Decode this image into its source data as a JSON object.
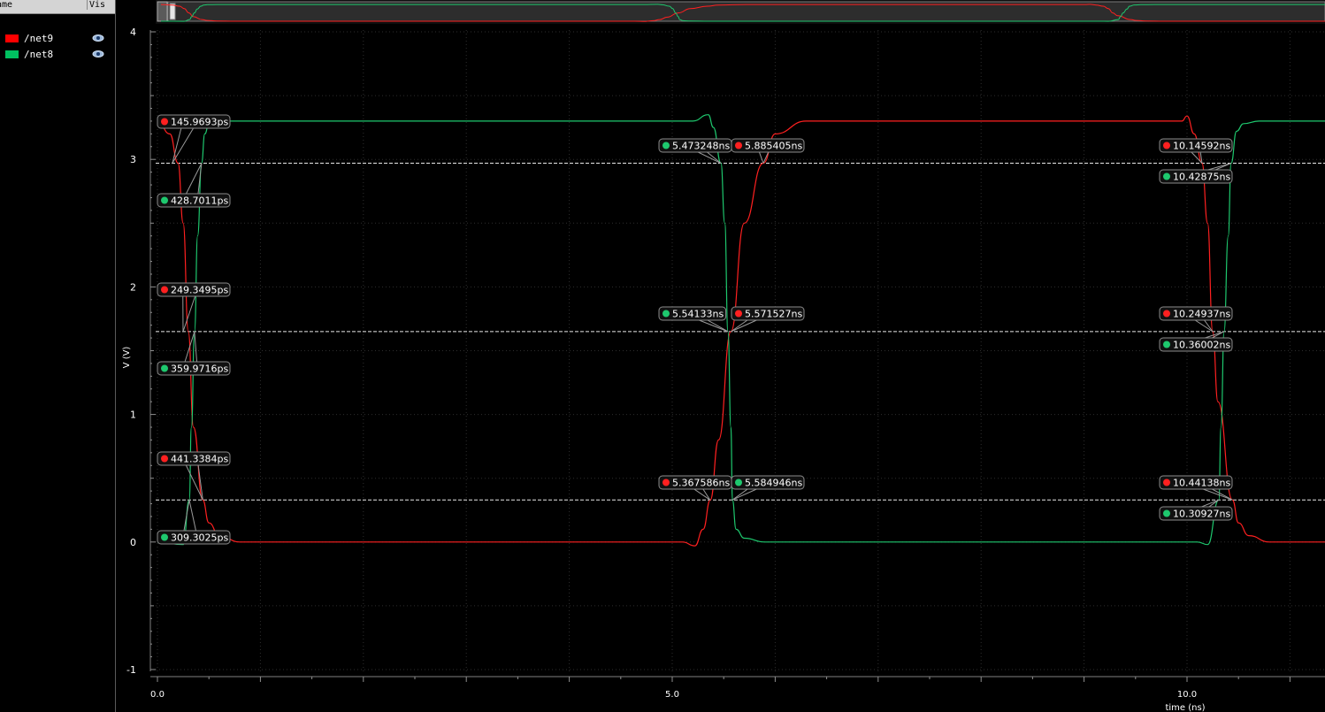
{
  "legend": {
    "header_name": "ame",
    "header_vis": "Vis",
    "items": [
      {
        "name": "/net9",
        "color": "#ff0000",
        "icon": "eye-icon"
      },
      {
        "name": "/net8",
        "color": "#00c060",
        "icon": "eye-icon"
      }
    ]
  },
  "colors": {
    "net9": "#ff2020",
    "net8": "#1ec86e",
    "background": "#000000",
    "grid": "#333333"
  },
  "chart_data": {
    "type": "line",
    "xlabel": "time (ns)",
    "ylabel": "V (V)",
    "xlim": [
      0,
      13.8
    ],
    "ylim": [
      -1,
      4
    ],
    "x_ticks": [
      "0.0",
      "5.0",
      "10.0"
    ],
    "y_ticks": [
      "4",
      "3",
      "2",
      "1",
      "0",
      "-1"
    ],
    "threshold_lines": [
      2.97,
      1.65,
      0.33
    ],
    "series": [
      {
        "name": "/net9",
        "color": "#ff2020",
        "x": [
          0.0,
          0.12,
          0.2,
          0.25,
          0.3,
          0.35,
          0.44,
          0.5,
          0.6,
          0.8,
          5.1,
          5.22,
          5.3,
          5.37,
          5.45,
          5.57,
          5.7,
          5.885,
          6.0,
          6.3,
          9.95,
          10.0,
          10.07,
          10.146,
          10.2,
          10.249,
          10.3,
          10.441,
          10.5,
          10.6,
          10.8,
          13.8
        ],
        "y": [
          3.3,
          3.2,
          2.97,
          2.5,
          1.65,
          0.9,
          0.33,
          0.15,
          0.05,
          0.0,
          0.0,
          -0.03,
          0.1,
          0.33,
          0.8,
          1.65,
          2.5,
          2.97,
          3.2,
          3.3,
          3.3,
          3.34,
          3.2,
          2.97,
          2.5,
          1.65,
          1.1,
          0.33,
          0.15,
          0.05,
          0.0,
          0.0
        ]
      },
      {
        "name": "/net8",
        "color": "#1ec86e",
        "x": [
          0.0,
          0.25,
          0.309,
          0.33,
          0.36,
          0.39,
          0.429,
          0.46,
          0.5,
          0.6,
          5.2,
          5.35,
          5.4,
          5.473,
          5.51,
          5.541,
          5.57,
          5.585,
          5.62,
          5.7,
          5.9,
          10.1,
          10.2,
          10.309,
          10.33,
          10.36,
          10.4,
          10.429,
          10.48,
          10.55,
          10.7,
          13.8
        ],
        "y": [
          0.0,
          -0.02,
          0.33,
          0.9,
          1.65,
          2.4,
          2.97,
          3.2,
          3.28,
          3.3,
          3.3,
          3.35,
          3.25,
          2.97,
          2.5,
          1.65,
          0.9,
          0.33,
          0.1,
          0.03,
          0.0,
          0.0,
          -0.02,
          0.33,
          0.9,
          1.65,
          2.4,
          2.97,
          3.22,
          3.28,
          3.3,
          3.3
        ]
      }
    ],
    "markers": [
      {
        "text": "145.9693ps",
        "series": "net9"
      },
      {
        "text": "428.7011ps",
        "series": "net8"
      },
      {
        "text": "249.3495ps",
        "series": "net9"
      },
      {
        "text": "359.9716ps",
        "series": "net8"
      },
      {
        "text": "441.3384ps",
        "series": "net9"
      },
      {
        "text": "309.3025ps",
        "series": "net8"
      },
      {
        "text": "5.473248ns",
        "series": "net8"
      },
      {
        "text": "5.885405ns",
        "series": "net9"
      },
      {
        "text": "5.54133ns",
        "series": "net8"
      },
      {
        "text": "5.571527ns",
        "series": "net9"
      },
      {
        "text": "5.367586ns",
        "series": "net9"
      },
      {
        "text": "5.584946ns",
        "series": "net8"
      },
      {
        "text": "10.14592ns",
        "series": "net9"
      },
      {
        "text": "10.42875ns",
        "series": "net8"
      },
      {
        "text": "10.24937ns",
        "series": "net9"
      },
      {
        "text": "10.36002ns",
        "series": "net8"
      },
      {
        "text": "10.44138ns",
        "series": "net9"
      },
      {
        "text": "10.30927ns",
        "series": "net8"
      }
    ]
  }
}
